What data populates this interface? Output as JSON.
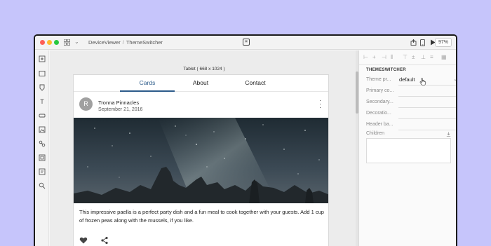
{
  "titlebar": {
    "breadcrumb": [
      "DeviceViewer",
      "ThemeSwitcher"
    ],
    "breadcrumb_sep": "/",
    "zoom": "97%",
    "center_icon_glyph": "⌘"
  },
  "canvas": {
    "frame_label": "Tablet ( 668 x 1024 )"
  },
  "card": {
    "tabs": [
      "Cards",
      "About",
      "Contact"
    ],
    "active_tab": "Cards",
    "avatar_letter": "R",
    "author": "Tronna Pinnacles",
    "date": "September 21, 2016",
    "description": "This impressive paella is a perfect party dish and a fun meal to cook together with your guests. Add 1 cup of frozen peas along with the mussels, if you like.",
    "icons": {
      "more": "more-vert-icon",
      "favorite": "heart-icon",
      "share": "share-icon"
    }
  },
  "panel": {
    "section_title": "THEMESWITCHER",
    "props": [
      {
        "label": "Theme pr...",
        "value": "default"
      },
      {
        "label": "Primary co...",
        "value": ""
      },
      {
        "label": "Secondary...",
        "value": ""
      },
      {
        "label": "Decoratio...",
        "value": ""
      },
      {
        "label": "Header ba...",
        "value": ""
      }
    ],
    "children_label": "Children"
  },
  "colors": {
    "background": "#c6c5fb",
    "accent": "#2c5b8a"
  }
}
